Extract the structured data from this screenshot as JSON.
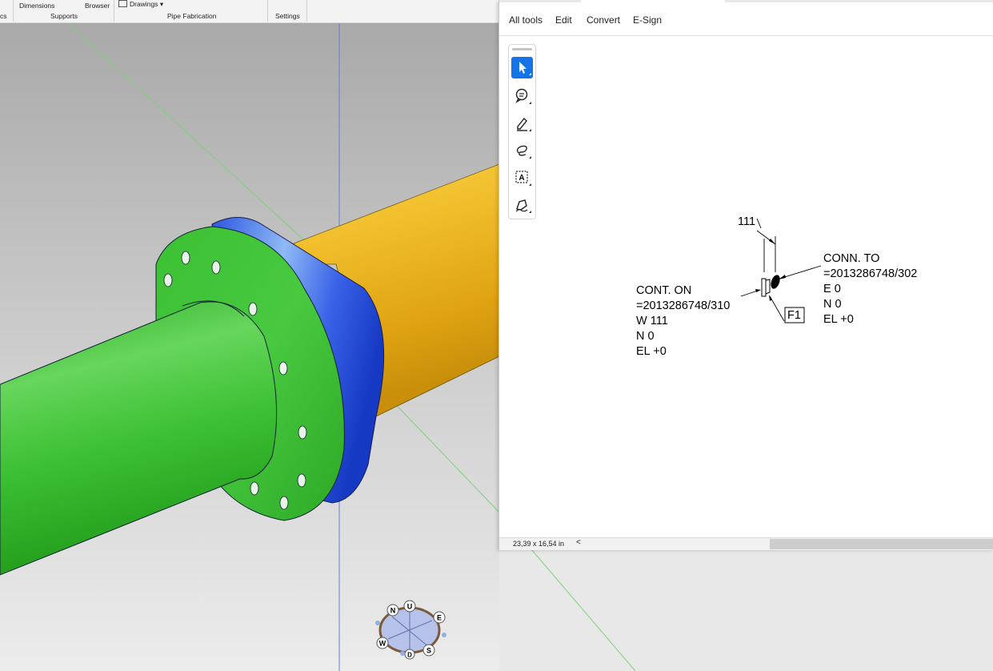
{
  "ribbon": {
    "cut_left": "cs",
    "dimensions": "Dimensions",
    "browser": "Browser",
    "drawings": "Drawings",
    "supports": "Supports",
    "pipe_fabrication": "Pipe Fabrication",
    "settings": "Settings"
  },
  "viewcube": {
    "north": "N",
    "up": "U",
    "east": "E",
    "west": "W",
    "south": "S",
    "down": "D"
  },
  "pdf": {
    "menu": [
      "All tools",
      "Edit",
      "Convert",
      "E-Sign"
    ],
    "tools": [
      "select-icon",
      "comment-icon",
      "highlight-icon",
      "draw-icon",
      "text-box-icon",
      "sign-icon"
    ],
    "drawing": {
      "dim": "111",
      "conn_to": "CONN. TO\n=2013286748/302\nE 0\nN 0\nEL +0",
      "cont_on": "CONT. ON\n=2013286748/310\nW 111\nN 0\nEL +0",
      "flag": "F1"
    },
    "status": {
      "page_size": "23,39 x 16,54 in",
      "scroll_left": "<"
    }
  },
  "colors": {
    "pipe_green": "#3fbf35",
    "flange_blue": "#3a63e8",
    "pipe_yellow": "#f2c02e",
    "accent": "#1473e6"
  }
}
